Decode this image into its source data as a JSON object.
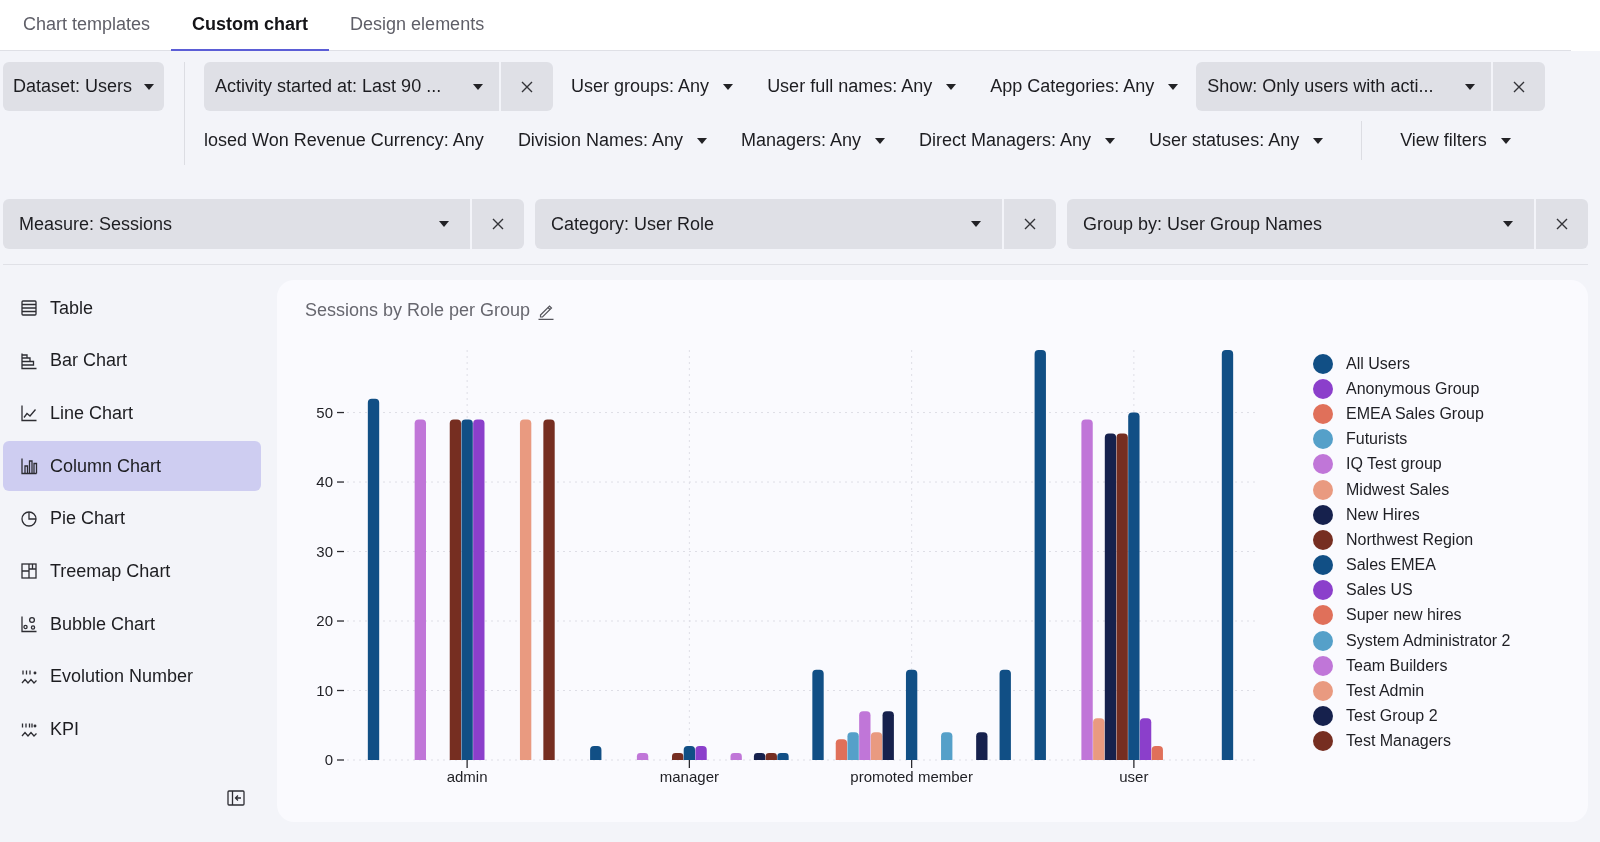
{
  "tabs": [
    {
      "label": "Chart templates",
      "selected": false
    },
    {
      "label": "Custom chart",
      "selected": true
    },
    {
      "label": "Design elements",
      "selected": false
    }
  ],
  "dataset": {
    "label": "Dataset: Users"
  },
  "filters": {
    "rows": [
      [
        {
          "label": "Activity started at: Last 90 ...",
          "kind": "dropdown",
          "applied": true
        },
        {
          "label": "User groups: Any",
          "kind": "dropdown",
          "applied": false
        },
        {
          "label": "User full names: Any",
          "kind": "dropdown",
          "applied": false
        },
        {
          "label": "App Categories: Any",
          "kind": "dropdown",
          "applied": false
        },
        {
          "label": "Show: Only users with acti...",
          "kind": "dropdown",
          "applied": true
        }
      ],
      [
        {
          "label": "losed Won Revenue Currency: Any",
          "kind": "text",
          "applied": false
        },
        {
          "label": "Division Names: Any",
          "kind": "dropdown",
          "applied": false
        },
        {
          "label": "Managers: Any",
          "kind": "dropdown",
          "applied": false
        },
        {
          "label": "Direct Managers: Any",
          "kind": "dropdown",
          "applied": false
        },
        {
          "label": "User statuses: Any",
          "kind": "dropdown",
          "applied": false
        }
      ]
    ],
    "view_filters": {
      "label": "View filters"
    }
  },
  "chart_settings": [
    {
      "label": "Measure: Sessions"
    },
    {
      "label": "Category: User Role"
    },
    {
      "label": "Group by: User Group Names"
    }
  ],
  "sidebar": {
    "items": [
      {
        "label": "Table",
        "kind": "table",
        "selected": false
      },
      {
        "label": "Bar Chart",
        "kind": "bar",
        "selected": false
      },
      {
        "label": "Line Chart",
        "kind": "line",
        "selected": false
      },
      {
        "label": "Column Chart",
        "kind": "column",
        "selected": true
      },
      {
        "label": "Pie Chart",
        "kind": "pie",
        "selected": false
      },
      {
        "label": "Treemap Chart",
        "kind": "treemap",
        "selected": false
      },
      {
        "label": "Bubble Chart",
        "kind": "bubble",
        "selected": false
      },
      {
        "label": "Evolution Number",
        "kind": "evolution",
        "selected": false
      },
      {
        "label": "KPI",
        "kind": "kpi",
        "selected": false
      }
    ]
  },
  "chart": {
    "chart_data": {
      "type": "bar",
      "title": "Sessions by Role per Group",
      "categories": [
        "admin",
        "manager",
        "promoted member",
        "user"
      ],
      "series": [
        {
          "name": "All Users",
          "color": "#114f85",
          "values": [
            52,
            2,
            13,
            59
          ]
        },
        {
          "name": "Anonymous Group",
          "color": "#8b3fcb",
          "values": [
            0,
            0,
            0,
            0
          ]
        },
        {
          "name": "EMEA Sales Group",
          "color": "#e0705a",
          "values": [
            0,
            0,
            3,
            0
          ]
        },
        {
          "name": "Futurists",
          "color": "#55a0c9",
          "values": [
            0,
            0,
            4,
            0
          ]
        },
        {
          "name": "IQ Test group",
          "color": "#c076d8",
          "values": [
            49,
            1,
            7,
            49
          ]
        },
        {
          "name": "Midwest Sales",
          "color": "#e99a80",
          "values": [
            0,
            0,
            4,
            6
          ]
        },
        {
          "name": "New Hires",
          "color": "#16214d",
          "values": [
            0,
            0,
            7,
            47
          ]
        },
        {
          "name": "Northwest Region",
          "color": "#762e21",
          "values": [
            49,
            1,
            0,
            47
          ]
        },
        {
          "name": "Sales EMEA",
          "color": "#114f85",
          "values": [
            49,
            2,
            13,
            50
          ]
        },
        {
          "name": "Sales US",
          "color": "#8b3fcb",
          "values": [
            49,
            2,
            0,
            6
          ]
        },
        {
          "name": "Super new hires",
          "color": "#e0705a",
          "values": [
            0,
            0,
            0,
            2
          ]
        },
        {
          "name": "System Administrator 2",
          "color": "#55a0c9",
          "values": [
            0,
            0,
            4,
            0
          ]
        },
        {
          "name": "Team Builders",
          "color": "#c076d8",
          "values": [
            0,
            1,
            0,
            0
          ]
        },
        {
          "name": "Test Admin",
          "color": "#e99a80",
          "values": [
            49,
            0,
            0,
            0
          ]
        },
        {
          "name": "Test Group 2",
          "color": "#16214d",
          "values": [
            0,
            1,
            4,
            0
          ]
        },
        {
          "name": "Test Managers",
          "color": "#762e21",
          "values": [
            49,
            1,
            0,
            0
          ]
        },
        {
          "color": "#114f85",
          "values": [
            0,
            1,
            13,
            59
          ]
        }
      ],
      "ylim": [
        0,
        59
      ],
      "yticks": [
        0,
        10,
        20,
        30,
        40,
        50
      ],
      "grid": true,
      "legend": true
    }
  }
}
